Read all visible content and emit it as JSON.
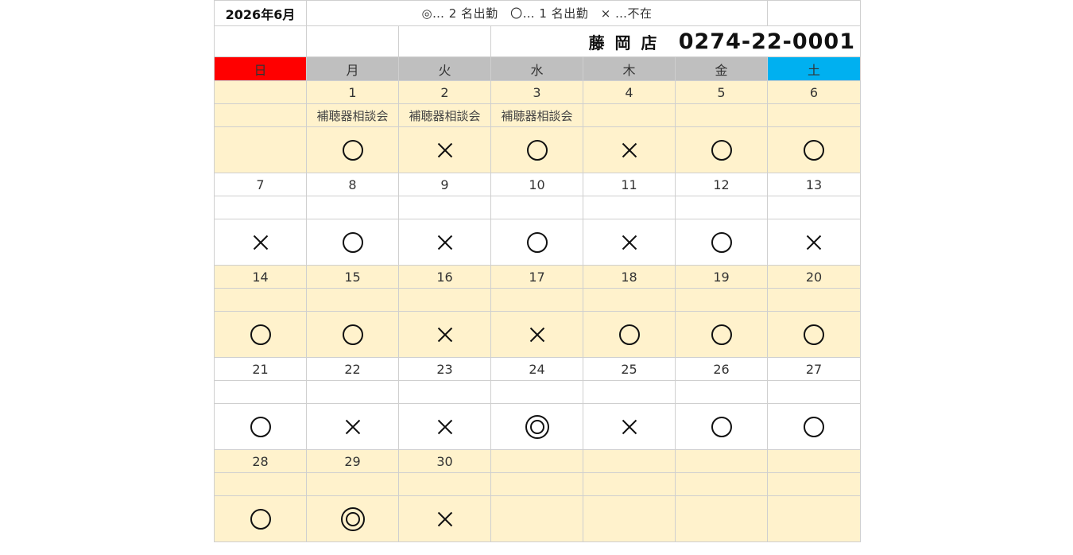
{
  "title": "2026年6月",
  "legend": "◎… 2 名出勤　〇… 1 名出勤　× …不在",
  "store": {
    "name": "藤 岡 店",
    "phone": "0274-22-0001"
  },
  "weekdays": [
    "日",
    "月",
    "火",
    "水",
    "木",
    "金",
    "土"
  ],
  "weeks": [
    {
      "days": [
        "",
        "1",
        "2",
        "3",
        "4",
        "5",
        "6"
      ],
      "events": [
        "",
        "補聴器相談会",
        "補聴器相談会",
        "補聴器相談会",
        "",
        "",
        ""
      ],
      "marks": [
        "none",
        "circle",
        "cross",
        "circle",
        "cross",
        "circle",
        "circle"
      ]
    },
    {
      "days": [
        "7",
        "8",
        "9",
        "10",
        "11",
        "12",
        "13"
      ],
      "events": [
        "",
        "",
        "",
        "",
        "",
        "",
        ""
      ],
      "marks": [
        "cross",
        "circle",
        "cross",
        "circle",
        "cross",
        "circle",
        "cross"
      ]
    },
    {
      "days": [
        "14",
        "15",
        "16",
        "17",
        "18",
        "19",
        "20"
      ],
      "events": [
        "",
        "",
        "",
        "",
        "",
        "",
        ""
      ],
      "marks": [
        "circle",
        "circle",
        "cross",
        "cross",
        "circle",
        "circle",
        "circle"
      ]
    },
    {
      "days": [
        "21",
        "22",
        "23",
        "24",
        "25",
        "26",
        "27"
      ],
      "events": [
        "",
        "",
        "",
        "",
        "",
        "",
        ""
      ],
      "marks": [
        "circle",
        "cross",
        "cross",
        "double-circle",
        "cross",
        "circle",
        "circle"
      ]
    },
    {
      "days": [
        "28",
        "29",
        "30",
        "",
        "",
        "",
        ""
      ],
      "events": [
        "",
        "",
        "",
        "",
        "",
        "",
        ""
      ],
      "marks": [
        "circle",
        "double-circle",
        "cross",
        "none",
        "none",
        "none",
        "none"
      ]
    }
  ]
}
